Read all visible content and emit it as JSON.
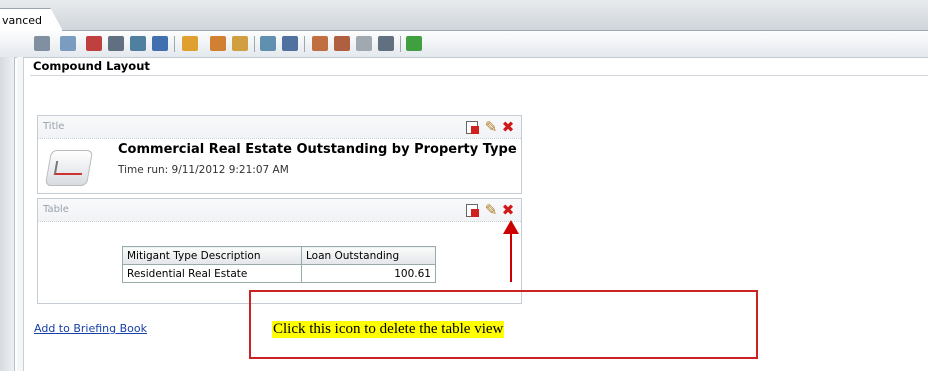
{
  "tab": {
    "label": "vanced"
  },
  "toolbar": {
    "icons": [
      "print-icon",
      "export-icon",
      "chart-icon",
      "pivot-icon",
      "filter-icon",
      "refresh-icon",
      "prompt-icon",
      "group-icon",
      "selector-icon",
      "layout-icon",
      "sql-icon",
      "new-view-icon",
      "compound-icon",
      "duplicate-icon",
      "narrative-icon",
      "sort-icon"
    ]
  },
  "layout": {
    "title": "Compound Layout"
  },
  "title_view": {
    "label": "Title",
    "report_title": "Commercial Real Estate Outstanding by Property Type",
    "time_run": "Time run: 9/11/2012 9:21:07 AM"
  },
  "table_view": {
    "label": "Table",
    "columns": [
      "Mitigant Type Description",
      "Loan Outstanding"
    ],
    "rows": [
      [
        "Residential Real Estate",
        "100.61"
      ]
    ]
  },
  "link": {
    "label": "Add to Briefing Book"
  },
  "callout": {
    "text": "Click this icon to delete the table view"
  },
  "colors": {
    "accent_red": "#cc0000",
    "highlight": "#ffff00",
    "link": "#1740a8"
  }
}
